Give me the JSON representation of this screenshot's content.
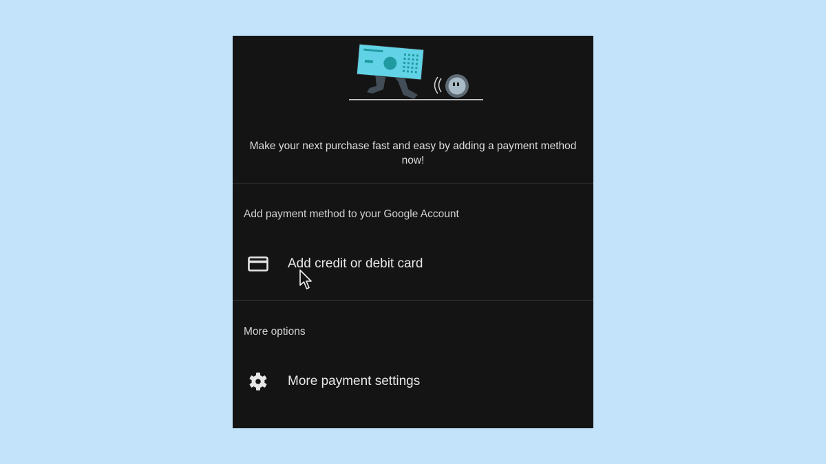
{
  "promo": {
    "text": "Make your next purchase fast and easy by adding a payment method now!"
  },
  "account_section": {
    "label": "Add payment method to your Google Account",
    "add_card": {
      "icon": "credit-card-icon",
      "label": "Add credit or debit card"
    }
  },
  "more_section": {
    "label": "More options",
    "settings": {
      "icon": "gear-icon",
      "label": "More payment settings"
    }
  },
  "colors": {
    "background": "#c2e3fa",
    "panel": "#141414",
    "illustration_teal": "#62d3e6",
    "illustration_dark_teal": "#1f9aa0"
  }
}
